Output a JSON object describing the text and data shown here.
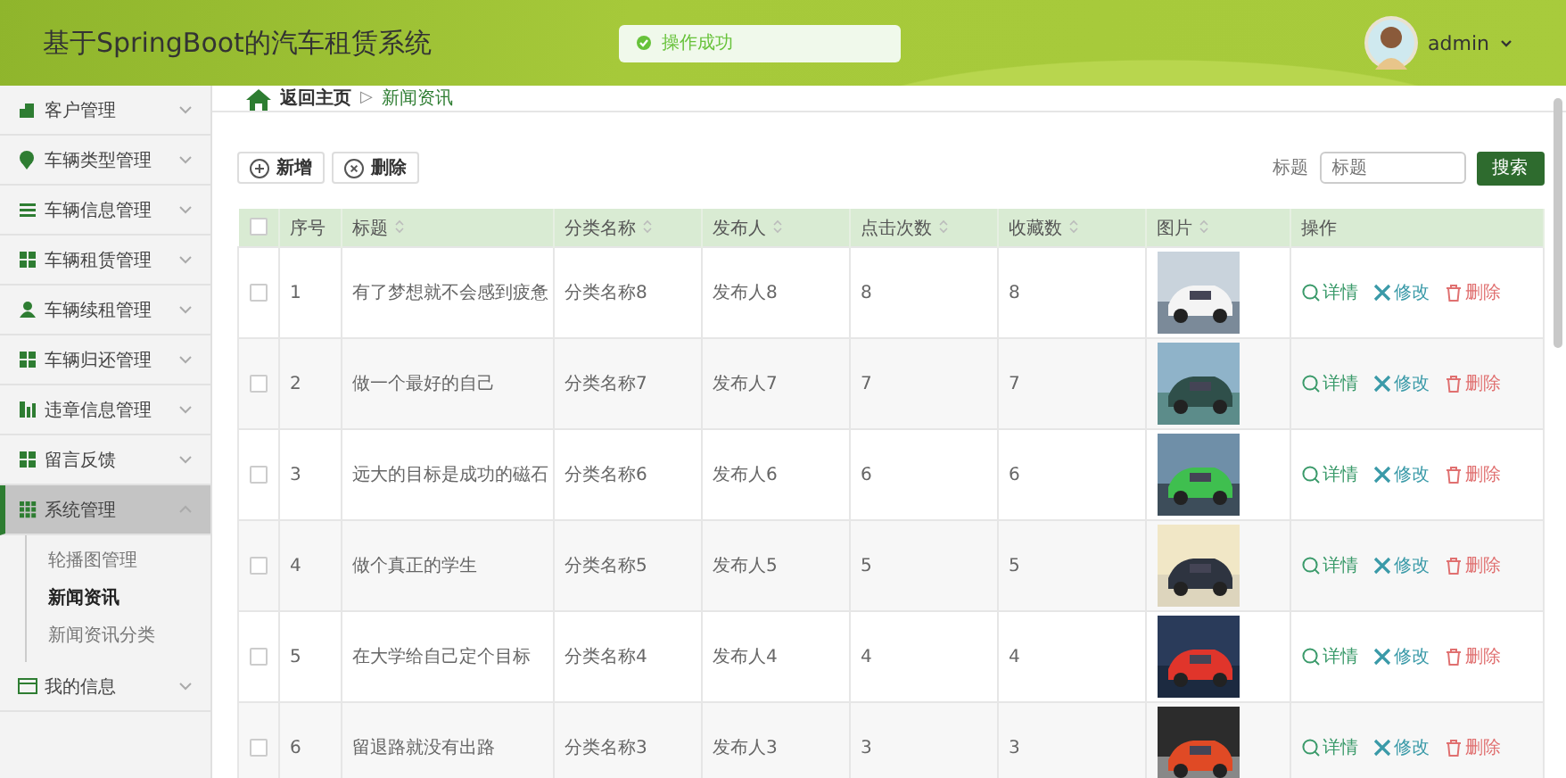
{
  "header": {
    "title": "基于SpringBoot的汽车租赁系统",
    "toast": "操作成功",
    "user": "admin"
  },
  "sidebar": {
    "items": [
      {
        "label": "客户管理",
        "expanded": false,
        "selected": false
      },
      {
        "label": "车辆类型管理",
        "expanded": false,
        "selected": false
      },
      {
        "label": "车辆信息管理",
        "expanded": false,
        "selected": false
      },
      {
        "label": "车辆租赁管理",
        "expanded": false,
        "selected": false
      },
      {
        "label": "车辆续租管理",
        "expanded": false,
        "selected": false
      },
      {
        "label": "车辆归还管理",
        "expanded": false,
        "selected": false
      },
      {
        "label": "违章信息管理",
        "expanded": false,
        "selected": false
      },
      {
        "label": "留言反馈",
        "expanded": false,
        "selected": false
      },
      {
        "label": "系统管理",
        "expanded": true,
        "selected": true,
        "children": [
          {
            "label": "轮播图管理",
            "selected": false
          },
          {
            "label": "新闻资讯",
            "selected": true
          },
          {
            "label": "新闻资讯分类",
            "selected": false
          }
        ]
      },
      {
        "label": "我的信息",
        "expanded": false,
        "selected": false
      }
    ]
  },
  "breadcrumb": {
    "home": "返回主页",
    "separator": "▷",
    "current": "新闻资讯"
  },
  "toolbar": {
    "add": "新增",
    "delete": "删除",
    "search_label": "标题",
    "search_placeholder": "标题",
    "search_button": "搜索"
  },
  "table": {
    "all_checked": false,
    "columns": [
      {
        "label": "序号",
        "sortable": false
      },
      {
        "label": "标题",
        "sortable": true
      },
      {
        "label": "分类名称",
        "sortable": true
      },
      {
        "label": "发布人",
        "sortable": true
      },
      {
        "label": "点击次数",
        "sortable": true
      },
      {
        "label": "收藏数",
        "sortable": true
      },
      {
        "label": "图片",
        "sortable": true
      },
      {
        "label": "操作",
        "sortable": false
      }
    ],
    "rows": [
      {
        "checked": false,
        "cells": [
          "1",
          "有了梦想就不会感到疲惫",
          "分类名称8",
          "发布人8",
          "8",
          "8"
        ],
        "actions": [
          "详情",
          "修改",
          "删除"
        ]
      },
      {
        "checked": false,
        "cells": [
          "2",
          "做一个最好的自己",
          "分类名称7",
          "发布人7",
          "7",
          "7"
        ],
        "actions": [
          "详情",
          "修改",
          "删除"
        ]
      },
      {
        "checked": false,
        "cells": [
          "3",
          "远大的目标是成功的磁石",
          "分类名称6",
          "发布人6",
          "6",
          "6"
        ],
        "actions": [
          "详情",
          "修改",
          "删除"
        ]
      },
      {
        "checked": false,
        "cells": [
          "4",
          "做个真正的学生",
          "分类名称5",
          "发布人5",
          "5",
          "5"
        ],
        "actions": [
          "详情",
          "修改",
          "删除"
        ]
      },
      {
        "checked": false,
        "cells": [
          "5",
          "在大学给自己定个目标",
          "分类名称4",
          "发布人4",
          "4",
          "4"
        ],
        "actions": [
          "详情",
          "修改",
          "删除"
        ]
      },
      {
        "checked": false,
        "cells": [
          "6",
          "留退路就没有出路",
          "分类名称3",
          "发布人3",
          "3",
          "3"
        ],
        "actions": [
          "详情",
          "修改",
          "删除"
        ]
      }
    ]
  }
}
